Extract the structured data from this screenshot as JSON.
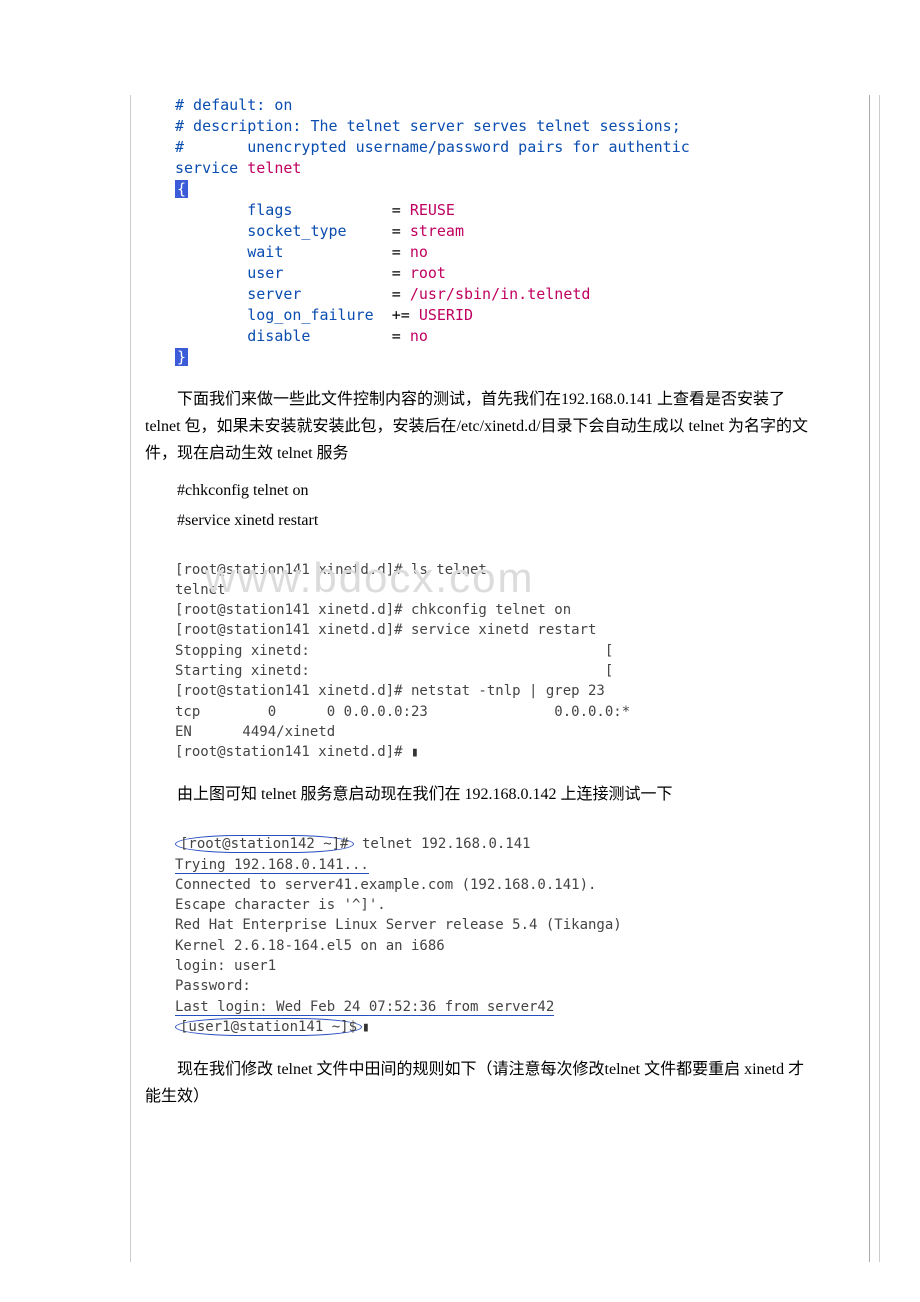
{
  "config": {
    "comment_default": "# default: on",
    "comment_desc1": "# description: The telnet server serves telnet sessions;",
    "comment_desc2": "#       unencrypted username/password pairs for authentic",
    "service_kw": "service",
    "service_name": "telnet",
    "brace_open": "{",
    "brace_close": "}",
    "rows": [
      {
        "k": "flags",
        "eq": "=",
        "v": "REUSE"
      },
      {
        "k": "socket_type",
        "eq": "=",
        "v": "stream"
      },
      {
        "k": "wait",
        "eq": "=",
        "v": "no"
      },
      {
        "k": "user",
        "eq": "=",
        "v": "root"
      },
      {
        "k": "server",
        "eq": "=",
        "v": "/usr/sbin/in.telnetd"
      },
      {
        "k": "log_on_failure",
        "eq": "+=",
        "v": "USERID"
      },
      {
        "k": "disable",
        "eq": "=",
        "v": "no"
      }
    ]
  },
  "para1": "下面我们来做一些此文件控制内容的测试，首先我们在192.168.0.141 上查看是否安装了 telnet 包，如果未安装就安装此包，安装后在/etc/xinetd.d/目录下会自动生成以 telnet 为名字的文件，现在启动生效 telnet 服务",
  "cmd1": "#chkconfig telnet on",
  "cmd2": "#service xinetd restart",
  "watermark": "www.bdocx.com",
  "term141": {
    "l1": "[root@station141 xinetd.d]# ls telnet",
    "l2": "telnet",
    "l3": "[root@station141 xinetd.d]# chkconfig telnet on",
    "l4": "[root@station141 xinetd.d]# service xinetd restart",
    "l5": "Stopping xinetd:                                   [",
    "l6": "Starting xinetd:                                   [",
    "l7": "[root@station141 xinetd.d]# netstat -tnlp | grep 23",
    "l8": "tcp        0      0 0.0.0.0:23               0.0.0.0:*",
    "l9": "EN      4494/xinetd",
    "l10": "[root@station141 xinetd.d]# "
  },
  "para2": "由上图可知 telnet 服务意启动现在我们在 192.168.0.142 上连接测试一下",
  "term142": {
    "prompt1a": "[root@station142 ~]#",
    "prompt1b": " telnet 192.168.0.141",
    "l2": "Trying 192.168.0.141...",
    "l3": "Connected to server41.example.com (192.168.0.141).",
    "l4": "Escape character is '^]'.",
    "l5": "Red Hat Enterprise Linux Server release 5.4 (Tikanga)",
    "l6": "Kernel 2.6.18-164.el5 on an i686",
    "l7": "login: user1",
    "l8": "Password:",
    "l9": "Last login: Wed Feb 24 07:52:36 from server42",
    "prompt2": "[user1@station141 ~]$"
  },
  "para3": "现在我们修改 telnet 文件中田间的规则如下（请注意每次修改telnet 文件都要重启 xinetd 才能生效）"
}
